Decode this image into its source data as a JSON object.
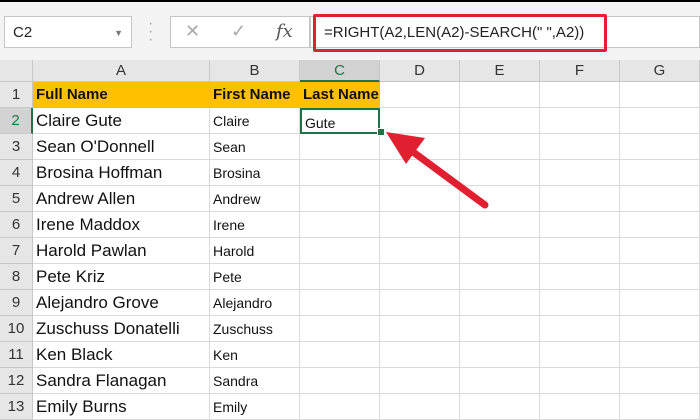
{
  "name_box": "C2",
  "formula_bar": {
    "cancel_icon": "✕",
    "enter_icon": "✓",
    "fx_label": "fx",
    "formula": "=RIGHT(A2,LEN(A2)-SEARCH(\" \",A2))"
  },
  "columns": [
    "A",
    "B",
    "C",
    "D",
    "E",
    "F",
    "G"
  ],
  "row_numbers": [
    "1",
    "2",
    "3",
    "4",
    "5",
    "6",
    "7",
    "8",
    "9",
    "10",
    "11",
    "12",
    "13"
  ],
  "headers": {
    "a": "Full Name",
    "b": "First Name",
    "c": "Last Name"
  },
  "rows": [
    {
      "a": "Claire Gute",
      "b": "Claire",
      "c": "Gute"
    },
    {
      "a": "Sean O'Donnell",
      "b": "Sean"
    },
    {
      "a": "Brosina Hoffman",
      "b": "Brosina"
    },
    {
      "a": "Andrew Allen",
      "b": "Andrew"
    },
    {
      "a": "Irene Maddox",
      "b": "Irene"
    },
    {
      "a": "Harold Pawlan",
      "b": "Harold"
    },
    {
      "a": "Pete Kriz",
      "b": "Pete"
    },
    {
      "a": "Alejandro Grove",
      "b": "Alejandro"
    },
    {
      "a": "Zuschuss Donatelli",
      "b": "Zuschuss"
    },
    {
      "a": "Ken Black",
      "b": "Ken"
    },
    {
      "a": "Sandra Flanagan",
      "b": "Sandra"
    },
    {
      "a": "Emily Burns",
      "b": "Emily"
    }
  ],
  "colors": {
    "highlight": "#e02030",
    "header_fill": "#ffc000",
    "selection": "#217346"
  }
}
